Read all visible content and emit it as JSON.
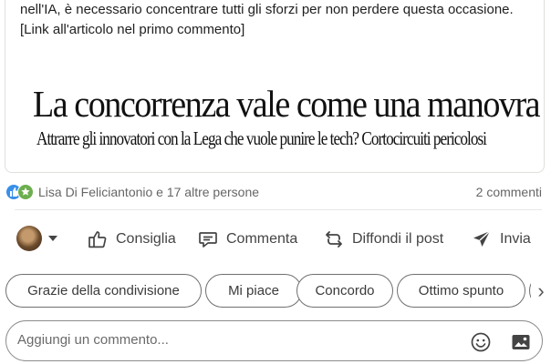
{
  "post": {
    "text": "solo da sperare che l'indiscrezione sia un equivoco. L'Italia ha un grande potenziale nell'IA, è necessario concentrare tutti gli sforzi per non perdere questa occasione.\n[Link all'articolo nel primo commento]",
    "image": {
      "headline": "La concorrenza vale come una manovra",
      "subheadline": "Attrarre gli innovatori con la Lega che vuole punire le tech? Cortocircuiti pericolosi"
    }
  },
  "social": {
    "reactions": [
      "like-icon",
      "support-icon"
    ],
    "reactors_text": "Lisa Di Feliciantonio e 17 altre persone",
    "comments_text": "2 commenti"
  },
  "actions": {
    "like": "Consiglia",
    "comment": "Commenta",
    "repost": "Diffondi il post",
    "send": "Invia"
  },
  "suggestions": [
    "Grazie della condivisione",
    "Mi piace",
    "Concordo",
    "Ottimo spunto",
    ""
  ],
  "comment_box": {
    "placeholder": "Aggiungi un commento..."
  },
  "colors": {
    "like_blue": "#378fe9",
    "support_green": "#6dae4f",
    "text_secondary": "#666666"
  }
}
